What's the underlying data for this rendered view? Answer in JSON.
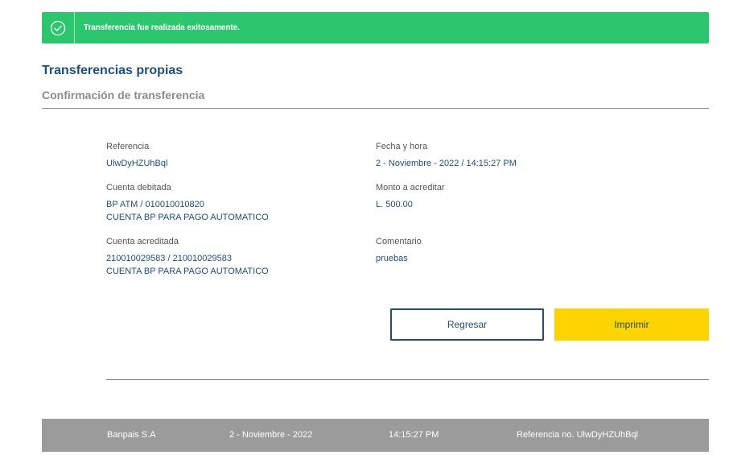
{
  "alert": {
    "icon": "check-circle-icon",
    "message": "Transferencia fue realizada exitosamente.",
    "color": "#2ec56f"
  },
  "header": {
    "title": "Transferencias propias",
    "subtitle": "Confirmación de transferencia"
  },
  "details": {
    "referencia": {
      "label": "Referencia",
      "value": "UlwDyHZUhBql"
    },
    "fecha": {
      "label": "Fecha y hora",
      "value": "2 - Noviembre - 2022 / 14:15:27 PM"
    },
    "cuenta_debitada": {
      "label": "Cuenta debitada",
      "line1": "BP ATM / 010010010820",
      "line2": "CUENTA BP PARA PAGO AUTOMATICO"
    },
    "monto": {
      "label": "Monto a acreditar",
      "value": "L. 500.00"
    },
    "cuenta_acreditada": {
      "label": "Cuenta acreditada",
      "line1": "210010029583 / 210010029583",
      "line2": "CUENTA BP PARA PAGO AUTOMATICO"
    },
    "comentario": {
      "label": "Comentario",
      "value": "pruebas"
    }
  },
  "buttons": {
    "back_label": "Regresar",
    "print_label": "Imprimir"
  },
  "footer": {
    "company": "Banpais S.A",
    "date": "2 - Noviembre - 2022",
    "time": "14:15:27 PM",
    "reference": "Referencia no.  UlwDyHZUhBql"
  },
  "colors": {
    "brand_blue": "#1f4e79",
    "accent_yellow": "#fdd400",
    "footer_gray": "#9b9b9b"
  }
}
